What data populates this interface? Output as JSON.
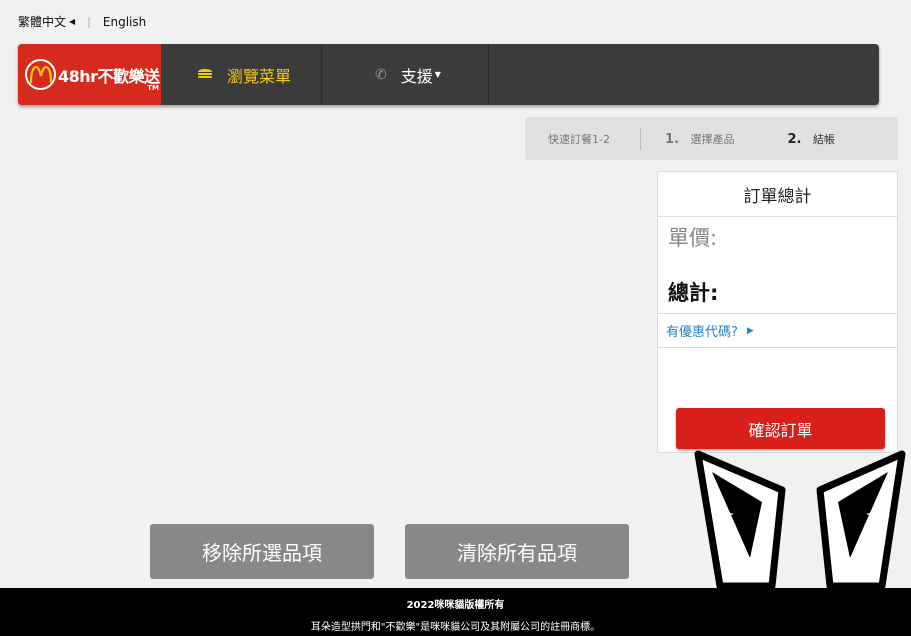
{
  "language": {
    "current": "繁體中文",
    "alternate": "English"
  },
  "nav": {
    "brand": "48hr不歡樂送",
    "brand_tm": "TM",
    "browse_label": "瀏覽菜單",
    "support_label": "支援"
  },
  "steps": {
    "quick": "快速訂餐1-2",
    "step1_num": "1.",
    "step1_label": "選擇產品",
    "step2_num": "2.",
    "step2_label": "結帳"
  },
  "summary": {
    "title": "訂單總計",
    "unit_price_label": "單價:",
    "total_label": "總計:",
    "promo_label": "有優惠代碼?",
    "confirm_label": "確認訂單"
  },
  "actions": {
    "remove_label": "移除所選品項",
    "clear_label": "清除所有品項"
  },
  "footer": {
    "line1": "2022咪咪貓版權所有",
    "line2": "耳朵造型拱門和\"不歡樂\"是咪咪貓公司及其附屬公司的註冊商標。"
  },
  "colors": {
    "brand_red": "#d62a1e",
    "nav_dark": "#3b3b3b",
    "accent_yellow": "#f5c518",
    "link_blue": "#2b86c5",
    "button_grey": "#888888"
  },
  "icons": {
    "logo": "arches-logo-icon",
    "browse": "burger-icon",
    "support": "phone-icon",
    "ears": "cat-ears-logo"
  }
}
